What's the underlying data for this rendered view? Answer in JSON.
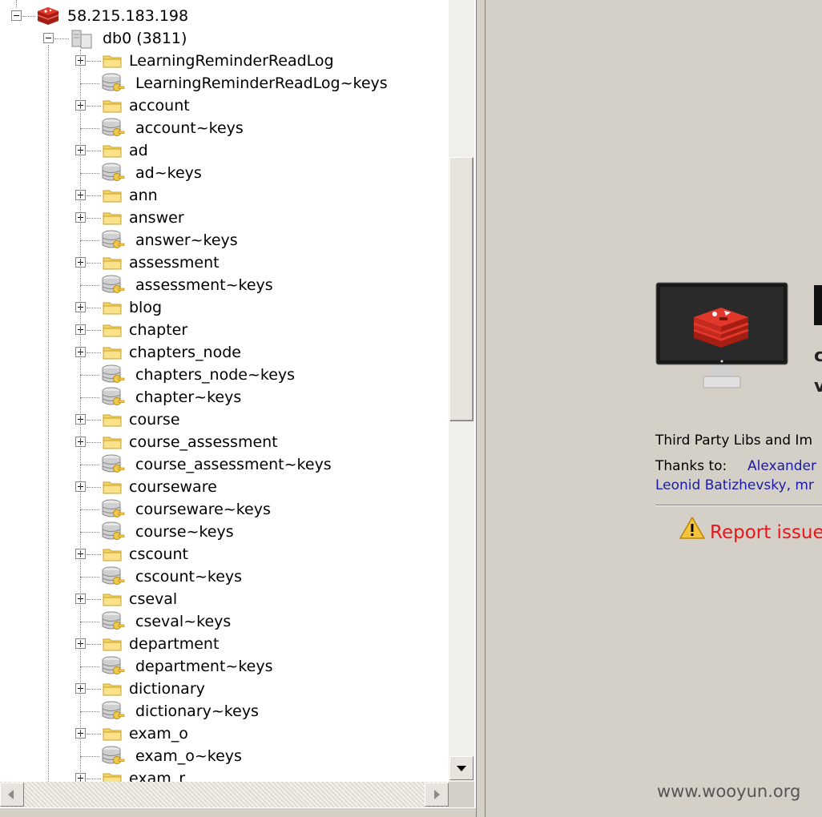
{
  "tree": {
    "server": "58.215.183.198",
    "database": "db0 (3811)",
    "items": [
      {
        "label": "LearningReminderReadLog",
        "type": "folder"
      },
      {
        "label": "LearningReminderReadLog~keys",
        "type": "keys"
      },
      {
        "label": "account",
        "type": "folder"
      },
      {
        "label": "account~keys",
        "type": "keys"
      },
      {
        "label": "ad",
        "type": "folder"
      },
      {
        "label": "ad~keys",
        "type": "keys"
      },
      {
        "label": "ann",
        "type": "folder"
      },
      {
        "label": "answer",
        "type": "folder"
      },
      {
        "label": "answer~keys",
        "type": "keys"
      },
      {
        "label": "assessment",
        "type": "folder"
      },
      {
        "label": "assessment~keys",
        "type": "keys"
      },
      {
        "label": "blog",
        "type": "folder"
      },
      {
        "label": "chapter",
        "type": "folder"
      },
      {
        "label": "chapters_node",
        "type": "folder"
      },
      {
        "label": "chapters_node~keys",
        "type": "keys"
      },
      {
        "label": "chapter~keys",
        "type": "keys"
      },
      {
        "label": "course",
        "type": "folder"
      },
      {
        "label": "course_assessment",
        "type": "folder"
      },
      {
        "label": "course_assessment~keys",
        "type": "keys"
      },
      {
        "label": "courseware",
        "type": "folder"
      },
      {
        "label": "courseware~keys",
        "type": "keys"
      },
      {
        "label": "course~keys",
        "type": "keys"
      },
      {
        "label": "cscount",
        "type": "folder"
      },
      {
        "label": "cscount~keys",
        "type": "keys"
      },
      {
        "label": "cseval",
        "type": "folder"
      },
      {
        "label": "cseval~keys",
        "type": "keys"
      },
      {
        "label": "department",
        "type": "folder"
      },
      {
        "label": "department~keys",
        "type": "keys"
      },
      {
        "label": "dictionary",
        "type": "folder"
      },
      {
        "label": "dictionary~keys",
        "type": "keys"
      },
      {
        "label": "exam_o",
        "type": "folder"
      },
      {
        "label": "exam_o~keys",
        "type": "keys"
      },
      {
        "label": "exam_r",
        "type": "folder"
      }
    ]
  },
  "about": {
    "glyph_1": "c",
    "glyph_2": "v",
    "third_party": "Third Party Libs and Im",
    "thanks_label": "Thanks to:",
    "thanks_name": "Alexander",
    "thanks_line2": "Leonid Batizhevsky, mr",
    "report": "Report issue"
  },
  "watermark": "www.wooyun.org",
  "colors": {
    "redis_red": "#d82c20",
    "folder_yellow": "#f6d463",
    "report_red": "#e8161b",
    "link_blue": "#1a1aa6"
  },
  "icons": [
    "redis-server-icon",
    "database-icon",
    "folder-icon",
    "keys-icon",
    "monitor-icon",
    "warning-icon"
  ]
}
